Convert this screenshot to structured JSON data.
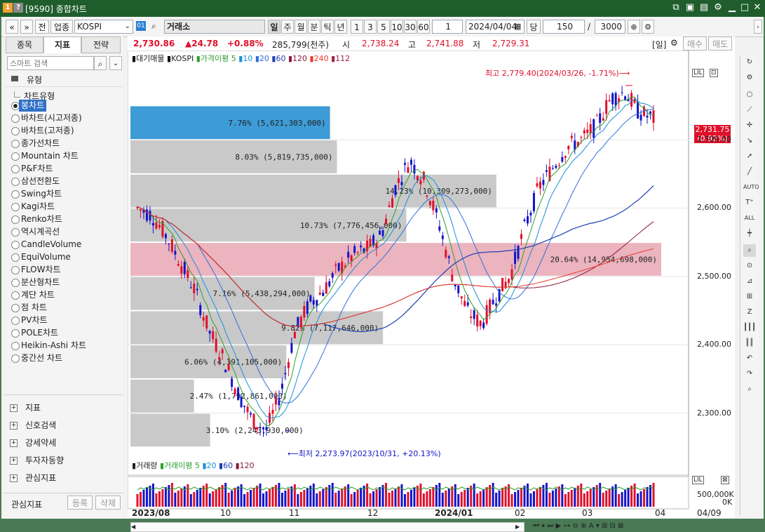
{
  "window": {
    "badge1": "1",
    "badge2": "?",
    "title": "[9590] 종합차트"
  },
  "toolbar": {
    "prev": "«",
    "next": "»",
    "jeon": "전",
    "industry": "업종",
    "market": "KOSPI",
    "code": "01",
    "market_name": "거래소",
    "periods": [
      "일",
      "주",
      "월",
      "분",
      "틱",
      "년"
    ],
    "active_period": "일",
    "nums": [
      "1",
      "3",
      "5",
      "10",
      "30",
      "60"
    ],
    "count1": "1",
    "date": "2024/04/04",
    "dang": "당",
    "count": "150",
    "slash": "/",
    "max": "3000"
  },
  "left": {
    "tabs": [
      "종목",
      "지표",
      "전략"
    ],
    "active_tab": "지표",
    "search_placeholder": "스마트 검색",
    "folder": "유형",
    "group": "차트유형",
    "chart_types": [
      "봉차트",
      "바차트(시고저종)",
      "바차트(고저종)",
      "종가선차트",
      "Mountain 차트",
      "P&F차트",
      "삼선전환도",
      "Swing차트",
      "Kagi차트",
      "Renko차트",
      "역시계곡선",
      "CandleVolume",
      "EquiVolume",
      "FLOW차트",
      "분산형차트",
      "계단 차트",
      "점 차트",
      "PV차트",
      "POLE차트",
      "Heikin-Ashi 차트",
      "중간선 차트"
    ],
    "sections": [
      "지표",
      "신호검색",
      "강세약세",
      "투자자동향",
      "관심지표"
    ],
    "footer_label": "관심지표",
    "register": "등록",
    "delete": "삭제"
  },
  "info": {
    "price": "2,730.86",
    "change": "▲24.78",
    "pct": "+0.88%",
    "volume": "285,799(천주)",
    "open_label": "시",
    "open": "2,738.24",
    "high_label": "고",
    "high": "2,741.88",
    "low_label": "저",
    "low": "2,729.31",
    "period": "[일]",
    "buy": "매수",
    "sell": "매도"
  },
  "legend": {
    "l1": "대기매물",
    "l2": "KOSPI",
    "l3": "가격이평 5",
    "l4": "10",
    "l5": "20",
    "l6": "60",
    "l7": "120",
    "l8": "240",
    "l9": "112"
  },
  "vol_legend": {
    "l1": "거래량",
    "l2": "거래이평 5",
    "l3": "20",
    "l4": "60",
    "l5": "120"
  },
  "annotations": {
    "max": "최고 2,779.40(2024/03/26, -1.71%)⟶",
    "min": "⟵최저 2,273.97(2023/10/31, +20.13%)"
  },
  "price_tag": {
    "value": "2,731.75",
    "pct": "(0.92%)"
  },
  "axis": {
    "price_ticks": [
      "2,700.00",
      "2,600.00",
      "2,500.00",
      "2,400.00",
      "2,300.00"
    ],
    "vol_ticks": [
      "500,000K",
      "0K"
    ],
    "dates": [
      "2023/08",
      "10",
      "11",
      "12",
      "2024/01",
      "02",
      "03",
      "04"
    ],
    "cursor_date": "04/09"
  },
  "chart_data": {
    "type": "candlestick",
    "title": "",
    "x_range": [
      "2023/08/01",
      "2024/04/04"
    ],
    "y_range": [
      2240,
      2810
    ],
    "candles": [
      {
        "x": "2023/08",
        "open": 2610,
        "high": 2630,
        "low": 2570,
        "close": 2580
      },
      {
        "x": "10",
        "open": 2450,
        "high": 2470,
        "low": 2370,
        "close": 2380
      },
      {
        "x": "11",
        "open": 2280,
        "high": 2380,
        "low": 2273.97,
        "close": 2370
      },
      {
        "x": "12",
        "open": 2500,
        "high": 2560,
        "low": 2480,
        "close": 2550
      },
      {
        "x": "2024/01",
        "open": 2640,
        "high": 2680,
        "low": 2430,
        "close": 2440
      },
      {
        "x": "02",
        "open": 2500,
        "high": 2640,
        "low": 2460,
        "close": 2630
      },
      {
        "x": "03",
        "open": 2660,
        "high": 2779.4,
        "low": 2630,
        "close": 2750
      },
      {
        "x": "04",
        "open": 2738.24,
        "high": 2741.88,
        "low": 2729.31,
        "close": 2730.86
      }
    ],
    "volume_profile": [
      {
        "pct": "7.76%",
        "amount": "5,621,303,000",
        "band": [
          2700,
          2750
        ]
      },
      {
        "pct": "8.03%",
        "amount": "5,819,735,000",
        "band": [
          2650,
          2700
        ]
      },
      {
        "pct": "14.23%",
        "amount": "10,309,273,000",
        "band": [
          2600,
          2650
        ]
      },
      {
        "pct": "10.73%",
        "amount": "7,776,456,000",
        "band": [
          2550,
          2600
        ]
      },
      {
        "pct": "20.64%",
        "amount": "14,954,698,000",
        "band": [
          2500,
          2550
        ]
      },
      {
        "pct": "7.16%",
        "amount": "5,438,294,000",
        "band": [
          2450,
          2500
        ]
      },
      {
        "pct": "9.82%",
        "amount": "7,117,646,000",
        "band": [
          2400,
          2450
        ]
      },
      {
        "pct": "6.06%",
        "amount": "4,391,105,000",
        "band": [
          2350,
          2400
        ]
      },
      {
        "pct": "2.47%",
        "amount": "1,792,861,000",
        "band": [
          2300,
          2350
        ]
      },
      {
        "pct": "3.10%",
        "amount": "2,243,930,000",
        "band": [
          2250,
          2300
        ]
      }
    ]
  },
  "colors": {
    "up": "#e0102a",
    "down": "#1414c8",
    "ma5": "#2e9e2e",
    "ma10": "#1a8fd8",
    "ma20": "#2f6fdd",
    "ma60": "#1d3fb3",
    "ma120": "#8b1a3a",
    "ma240": "#e83a2a",
    "ma112": "#a0204a",
    "highlight": "#e8a7b3",
    "profile": "#c9c9c9",
    "profile_top": "#3d9bd6"
  }
}
